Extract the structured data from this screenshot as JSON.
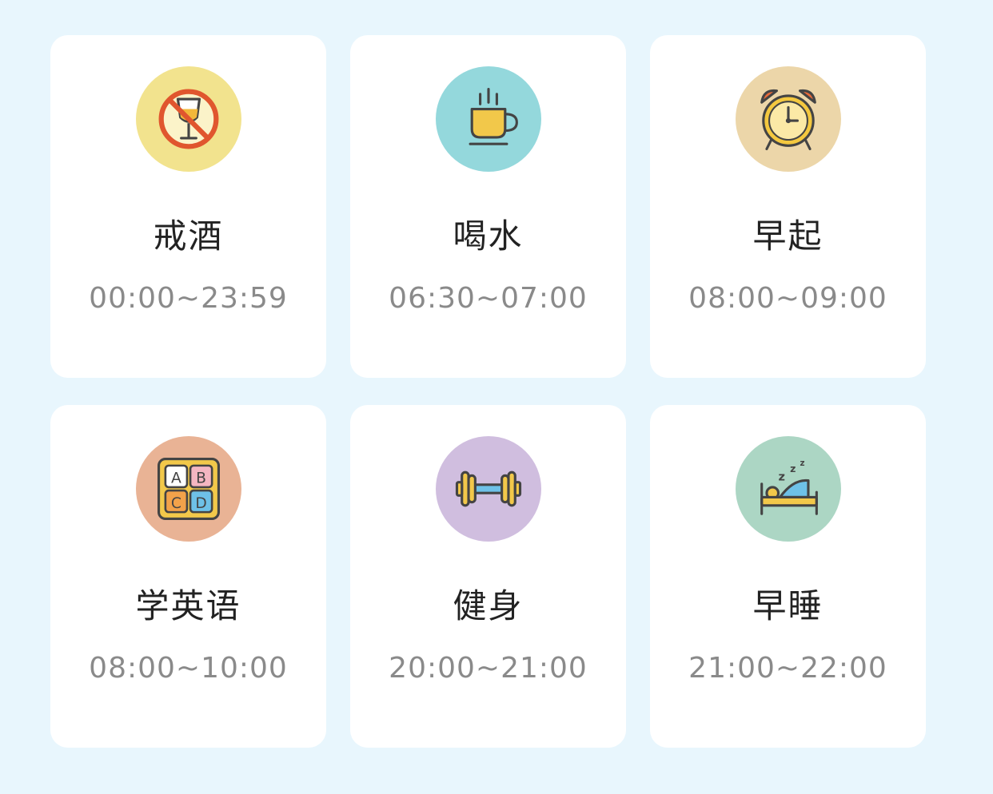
{
  "habits": [
    {
      "name": "戒酒",
      "time": "00:00~23:59",
      "icon": "no-alcohol-icon",
      "color": "#f2e38e"
    },
    {
      "name": "喝水",
      "time": "06:30~07:00",
      "icon": "coffee-cup-icon",
      "color": "#94d8dc"
    },
    {
      "name": "早起",
      "time": "08:00~09:00",
      "icon": "alarm-clock-icon",
      "color": "#ecd6a9"
    },
    {
      "name": "学英语",
      "time": "08:00~10:00",
      "icon": "abc-blocks-icon",
      "color": "#e9b395"
    },
    {
      "name": "健身",
      "time": "20:00~21:00",
      "icon": "dumbbell-icon",
      "color": "#d0bedf"
    },
    {
      "name": "早睡",
      "time": "21:00~22:00",
      "icon": "sleeping-bed-icon",
      "color": "#acd6c4"
    }
  ]
}
